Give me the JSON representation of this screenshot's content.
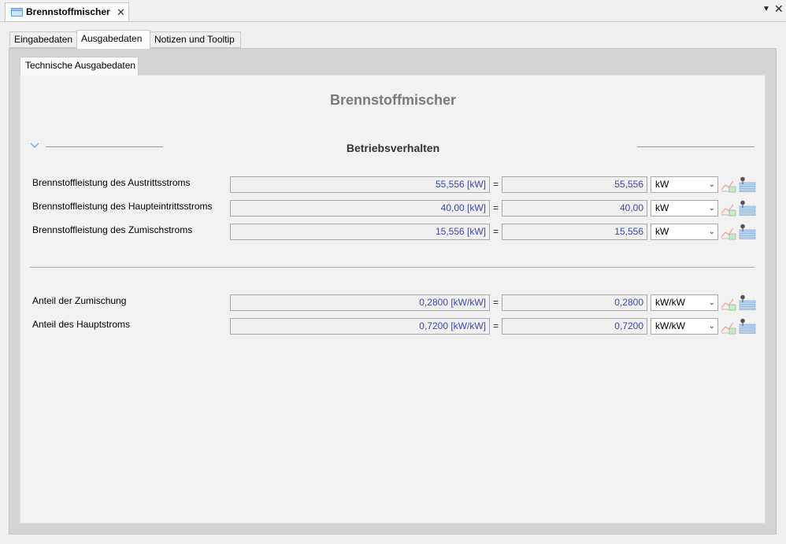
{
  "document_tab": {
    "title": "Brennstoffmischer",
    "close_glyph": "✕"
  },
  "window_controls": {
    "menu_glyph": "▼",
    "close_glyph": "✕"
  },
  "tabs": [
    {
      "label": "Eingabedaten"
    },
    {
      "label": "Ausgabedaten"
    },
    {
      "label": "Notizen und Tooltip"
    }
  ],
  "subtab": {
    "label": "Technische Ausgabedaten"
  },
  "main_title": "Brennstoffmischer",
  "section": {
    "title": "Betriebsverhalten"
  },
  "rows": [
    {
      "label": "Brennstoffleistung des Austrittsstroms",
      "formatted": "55,556 [kW]",
      "equals": "=",
      "value": "55,556",
      "unit": "kW"
    },
    {
      "label": "Brennstoffleistung des Haupteintrittsstroms",
      "formatted": "40,00 [kW]",
      "equals": "=",
      "value": "40,00",
      "unit": "kW"
    },
    {
      "label": "Brennstoffleistung des Zumischstroms",
      "formatted": "15,556 [kW]",
      "equals": "=",
      "value": "15,556",
      "unit": "kW"
    },
    {
      "label": "Anteil der Zumischung",
      "formatted": "0,2800 [kW/kW]",
      "equals": "=",
      "value": "0,2800",
      "unit": "kW/kW"
    },
    {
      "label": "Anteil des Hauptstroms",
      "formatted": "0,7200 [kW/kW]",
      "equals": "=",
      "value": "0,7200",
      "unit": "kW/kW"
    }
  ],
  "icons": {
    "row_chart": "line-chart-icon",
    "row_list": "list-pin-icon",
    "section_toggle": "chevron-down-icon",
    "tab": "component-icon"
  },
  "colors": {
    "value_text": "#3a46b4",
    "title_gray": "#7a7a7a"
  }
}
